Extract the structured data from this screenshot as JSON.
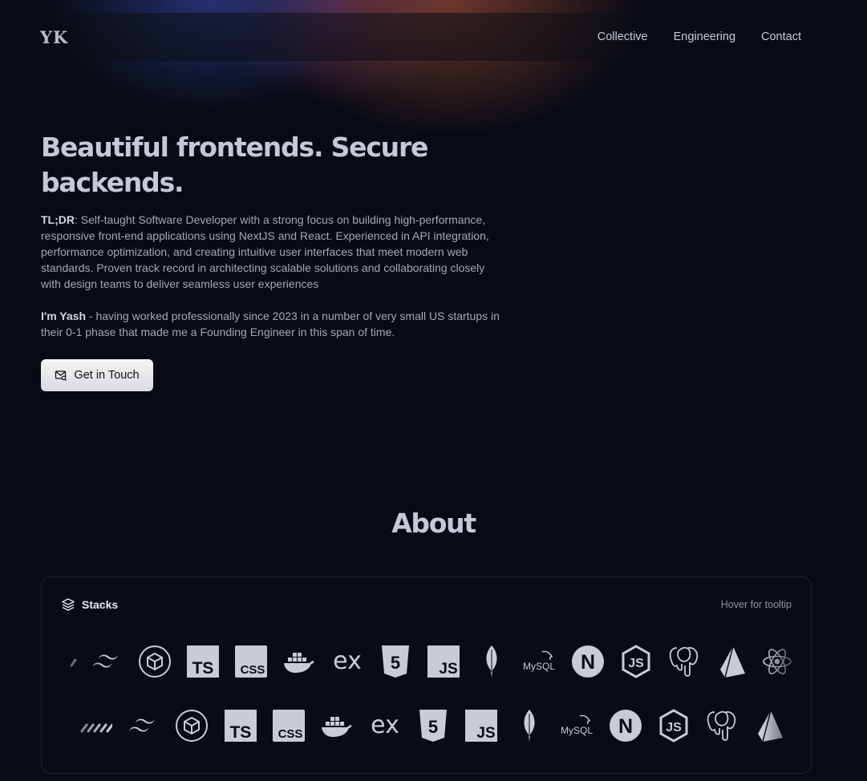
{
  "nav": {
    "logo": "YK",
    "links": [
      "Collective",
      "Engineering",
      "Contact"
    ]
  },
  "hero": {
    "title": "Beautiful frontends. Secure backends.",
    "tldr_label": "TL;DR",
    "tldr_text": ": Self-taught Software Developer with a strong focus on building high-performance, responsive front-end applications using NextJS and React. Experienced in API integration, performance optimization, and creating intuitive user interfaces that meet modern web standards. Proven track record in architecting scalable solutions and collaborating closely with design teams to deliver seamless user experiences",
    "intro_label": "I'm Yash",
    "intro_text": " - having worked professionally since 2023 in a number of very small US startups in their 0-1 phase that made me a Founding Engineer in this span of time.",
    "cta_label": "Get in Touch"
  },
  "about": {
    "title": "About",
    "stacks_title": "Stacks",
    "hint": "Hover for tooltip",
    "row1_icons": [
      "shadcn-icon",
      "tailwind-icon",
      "codesandbox-icon",
      "typescript-icon",
      "css-icon",
      "docker-icon",
      "express-icon",
      "html5-icon",
      "javascript-icon",
      "mongodb-icon",
      "mysql-icon",
      "nextjs-icon",
      "nodejs-icon",
      "postgresql-icon",
      "prisma-icon",
      "react-icon"
    ],
    "row2_icons": [
      "shadcn-icon",
      "tailwind-icon",
      "codesandbox-icon",
      "typescript-icon",
      "css-icon",
      "docker-icon",
      "express-icon",
      "html5-icon",
      "javascript-icon",
      "mongodb-icon",
      "mysql-icon",
      "nextjs-icon",
      "nodejs-icon",
      "postgresql-icon",
      "prisma-icon"
    ],
    "icon_labels": {
      "ts": "TS",
      "css": "CSS",
      "js": "JS",
      "ex": "ex",
      "mysql": "MySQL",
      "n": "N",
      "html": "5",
      "node": "JS"
    }
  },
  "colors": {
    "background": "#080b14",
    "icon": "#c9ccd3",
    "cta_bg": "#eeeef0"
  }
}
